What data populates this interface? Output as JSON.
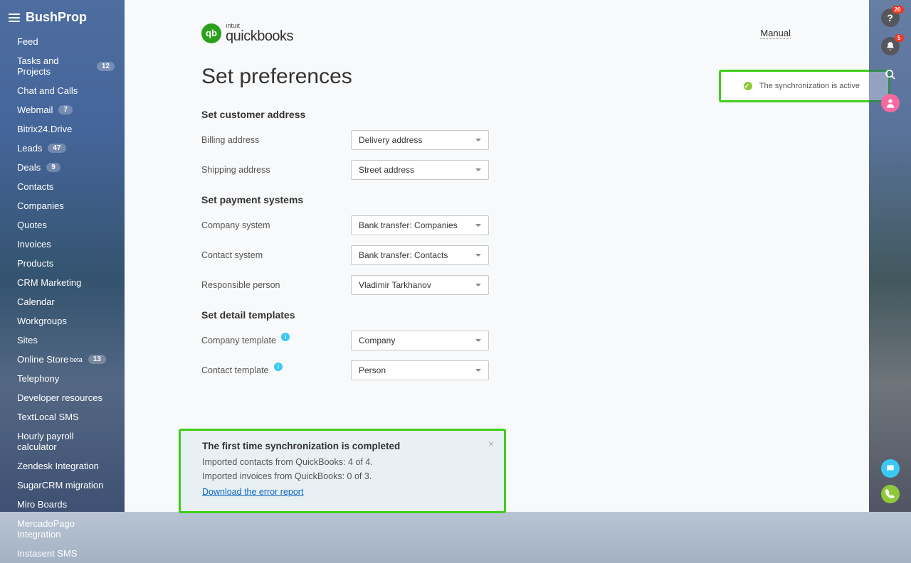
{
  "app": {
    "name": "BushProp"
  },
  "sidebar": {
    "items": [
      {
        "label": "Feed",
        "badge": ""
      },
      {
        "label": "Tasks and Projects",
        "badge": "12"
      },
      {
        "label": "Chat and Calls",
        "badge": ""
      },
      {
        "label": "Webmail",
        "badge": "7"
      },
      {
        "label": "Bitrix24.Drive",
        "badge": ""
      },
      {
        "label": "Leads",
        "badge": "47"
      },
      {
        "label": "Deals",
        "badge": "9"
      },
      {
        "label": "Contacts",
        "badge": ""
      },
      {
        "label": "Companies",
        "badge": ""
      },
      {
        "label": "Quotes",
        "badge": ""
      },
      {
        "label": "Invoices",
        "badge": ""
      },
      {
        "label": "Products",
        "badge": ""
      },
      {
        "label": "CRM Marketing",
        "badge": ""
      },
      {
        "label": "Calendar",
        "badge": ""
      },
      {
        "label": "Workgroups",
        "badge": ""
      },
      {
        "label": "Sites",
        "badge": ""
      },
      {
        "label": "Online Store",
        "badge": "13",
        "beta": "beta"
      },
      {
        "label": "Telephony",
        "badge": ""
      },
      {
        "label": "Developer resources",
        "badge": ""
      },
      {
        "label": "TextLocal SMS",
        "badge": ""
      },
      {
        "label": "Hourly payroll calculator",
        "badge": ""
      },
      {
        "label": "Zendesk Integration",
        "badge": ""
      },
      {
        "label": "SugarCRM migration",
        "badge": ""
      },
      {
        "label": "Miro Boards",
        "badge": ""
      },
      {
        "label": "MercadoPago Integration",
        "badge": ""
      },
      {
        "label": "Instasent SMS",
        "badge": ""
      }
    ]
  },
  "header": {
    "qb_intuit": "ıntuıt",
    "qb_name": "quickbooks",
    "qb_mark": "qb",
    "manual": "Manual"
  },
  "page": {
    "title": "Set preferences",
    "sync_status": "The synchronization is active"
  },
  "sections": {
    "customer_address": {
      "title": "Set customer address",
      "billing_label": "Billing address",
      "billing_value": "Delivery address",
      "shipping_label": "Shipping address",
      "shipping_value": "Street address"
    },
    "payment_systems": {
      "title": "Set payment systems",
      "company_label": "Company system",
      "company_value": "Bank transfer: Companies",
      "contact_label": "Contact system",
      "contact_value": "Bank transfer: Contacts",
      "responsible_label": "Responsible person",
      "responsible_value": "Vladimir Tarkhanov"
    },
    "detail_templates": {
      "title": "Set detail templates",
      "company_label": "Company template",
      "company_value": "Company",
      "contact_label": "Contact template",
      "contact_value": "Person"
    }
  },
  "notification": {
    "title": "The first time synchronization is completed",
    "line1": "Imported contacts from QuickBooks: 4 of 4.",
    "line2": "Imported invoices from QuickBooks: 0 of 3.",
    "link": "Download the error report"
  },
  "rightbar": {
    "help_badge": "20",
    "bell_badge": "5"
  }
}
